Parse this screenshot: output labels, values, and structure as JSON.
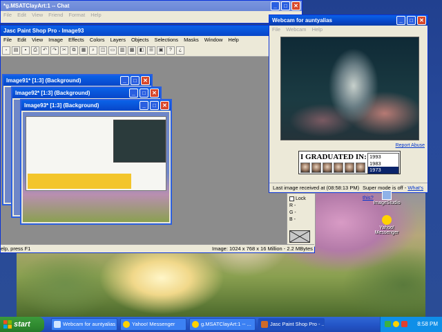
{
  "chat_window": {
    "title": "*g.MSATClayArt:1 -- Chat",
    "menu": [
      "File",
      "Edit",
      "View",
      "Friend",
      "Format",
      "Help"
    ]
  },
  "psp_window": {
    "title": "Jasc Paint Shop Pro - Image93",
    "menu": [
      "File",
      "Edit",
      "View",
      "Image",
      "Effects",
      "Colors",
      "Layers",
      "Objects",
      "Selections",
      "Masks",
      "Window",
      "Help"
    ],
    "status_left": "elp, press F1",
    "status_right": "Image:  1024 x 768 x 16 Million - 2.2 MBytes",
    "image_windows": [
      {
        "title": "Image91* [1:3] (Background)"
      },
      {
        "title": "Image92* [1:3] (Background)"
      },
      {
        "title": "Image93* [1:3] (Background)"
      }
    ],
    "layers_panel": {
      "lock_label": "Lock",
      "rows": [
        "R -",
        "G -",
        "B -"
      ]
    }
  },
  "webcam_window": {
    "title": "Webcam for auntyalias",
    "menu": [
      "File",
      "Webcam",
      "Help"
    ],
    "report_link": "Report Abuse",
    "ad": {
      "title": "I GRADUATED IN:",
      "years": [
        "1993",
        "1983",
        "1973"
      ],
      "selected_year": "1973"
    },
    "status_text": "Last image received at (08:58:13 PM)",
    "super_mode": "Super mode is off -",
    "whats_this": "What's this?"
  },
  "desktop_icons": [
    {
      "label": "ImageStudio",
      "icon": "imagestudio-icon"
    },
    {
      "label": "Yahoo!\nMessenger",
      "icon": "yahoo-messenger-icon"
    }
  ],
  "taskbar": {
    "start_label": "start",
    "buttons": [
      {
        "label": "Webcam for auntyalias",
        "icon": "webcam-icon"
      },
      {
        "label": "Yahoo! Messenger",
        "icon": "yahoo-icon"
      },
      {
        "label": "g.MSATClayArt:1 -- ...",
        "icon": "chat-icon"
      },
      {
        "label": "Jasc Paint Shop Pro - ...",
        "icon": "psp-icon"
      }
    ],
    "clock": "8:58 PM"
  },
  "colors": {
    "xp_blue": "#0846c8",
    "start_green": "#2f8a2f",
    "tray_blue": "#0f8fe8",
    "link_blue": "#0033cc"
  }
}
